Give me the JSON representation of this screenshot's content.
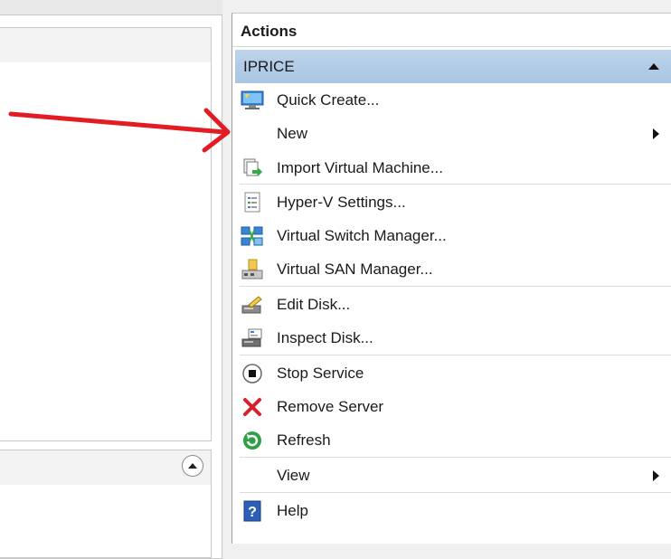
{
  "actions_pane": {
    "title": "Actions",
    "group": "IPRICE",
    "items": [
      {
        "label": "Quick Create...",
        "icon": "quick-create-icon"
      },
      {
        "label": "New",
        "icon": "none",
        "submenu": true
      },
      {
        "label": "Import Virtual Machine...",
        "icon": "import-vm-icon"
      },
      {
        "label": "Hyper-V Settings...",
        "icon": "settings-document-icon"
      },
      {
        "label": "Virtual Switch Manager...",
        "icon": "network-switch-icon"
      },
      {
        "label": "Virtual SAN Manager...",
        "icon": "san-manager-icon"
      },
      {
        "label": "Edit Disk...",
        "icon": "edit-disk-icon"
      },
      {
        "label": "Inspect Disk...",
        "icon": "inspect-disk-icon"
      },
      {
        "label": "Stop Service",
        "icon": "stop-icon"
      },
      {
        "label": "Remove Server",
        "icon": "red-x-icon"
      },
      {
        "label": "Refresh",
        "icon": "refresh-icon"
      },
      {
        "label": "View",
        "icon": "none",
        "submenu": true
      },
      {
        "label": "Help",
        "icon": "help-icon"
      }
    ]
  },
  "colors": {
    "group_header": "#a9c5e2",
    "annotation_arrow": "#e31b23",
    "remove_icon": "#d8202a",
    "refresh_icon": "#2ea043"
  }
}
